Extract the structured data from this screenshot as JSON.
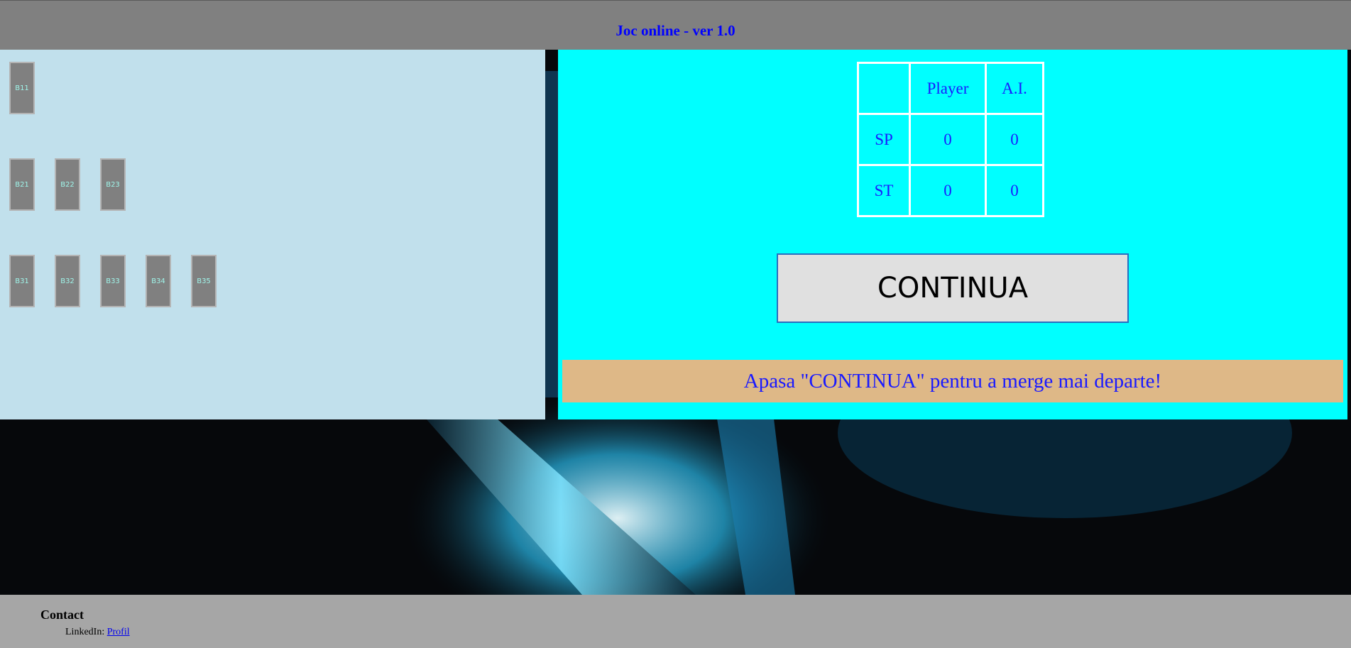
{
  "header": {
    "title": "Joc online - ver 1.0"
  },
  "board": {
    "rows": [
      [
        "B11"
      ],
      [
        "B21",
        "B22",
        "B23"
      ],
      [
        "B31",
        "B32",
        "B33",
        "B34",
        "B35"
      ]
    ]
  },
  "scoreboard": {
    "columns": [
      "",
      "Player",
      "A.I."
    ],
    "rows": [
      {
        "label": "SP",
        "player": "0",
        "ai": "0"
      },
      {
        "label": "ST",
        "player": "0",
        "ai": "0"
      }
    ]
  },
  "continue_button": {
    "label": "CONTINUA"
  },
  "message": "Apasa \"CONTINUA\" pentru a merge mai departe!",
  "footer": {
    "heading": "Contact",
    "linkedin_label": "LinkedIn:",
    "linkedin_link": "Profil"
  },
  "colors": {
    "header_bg": "#808080",
    "title": "#0000ff",
    "board_bg": "#c1e0ec",
    "panel_bg": "#00ffff",
    "message_bg": "#deb887",
    "card_bg": "#808080",
    "card_text": "#9ff5ea"
  }
}
